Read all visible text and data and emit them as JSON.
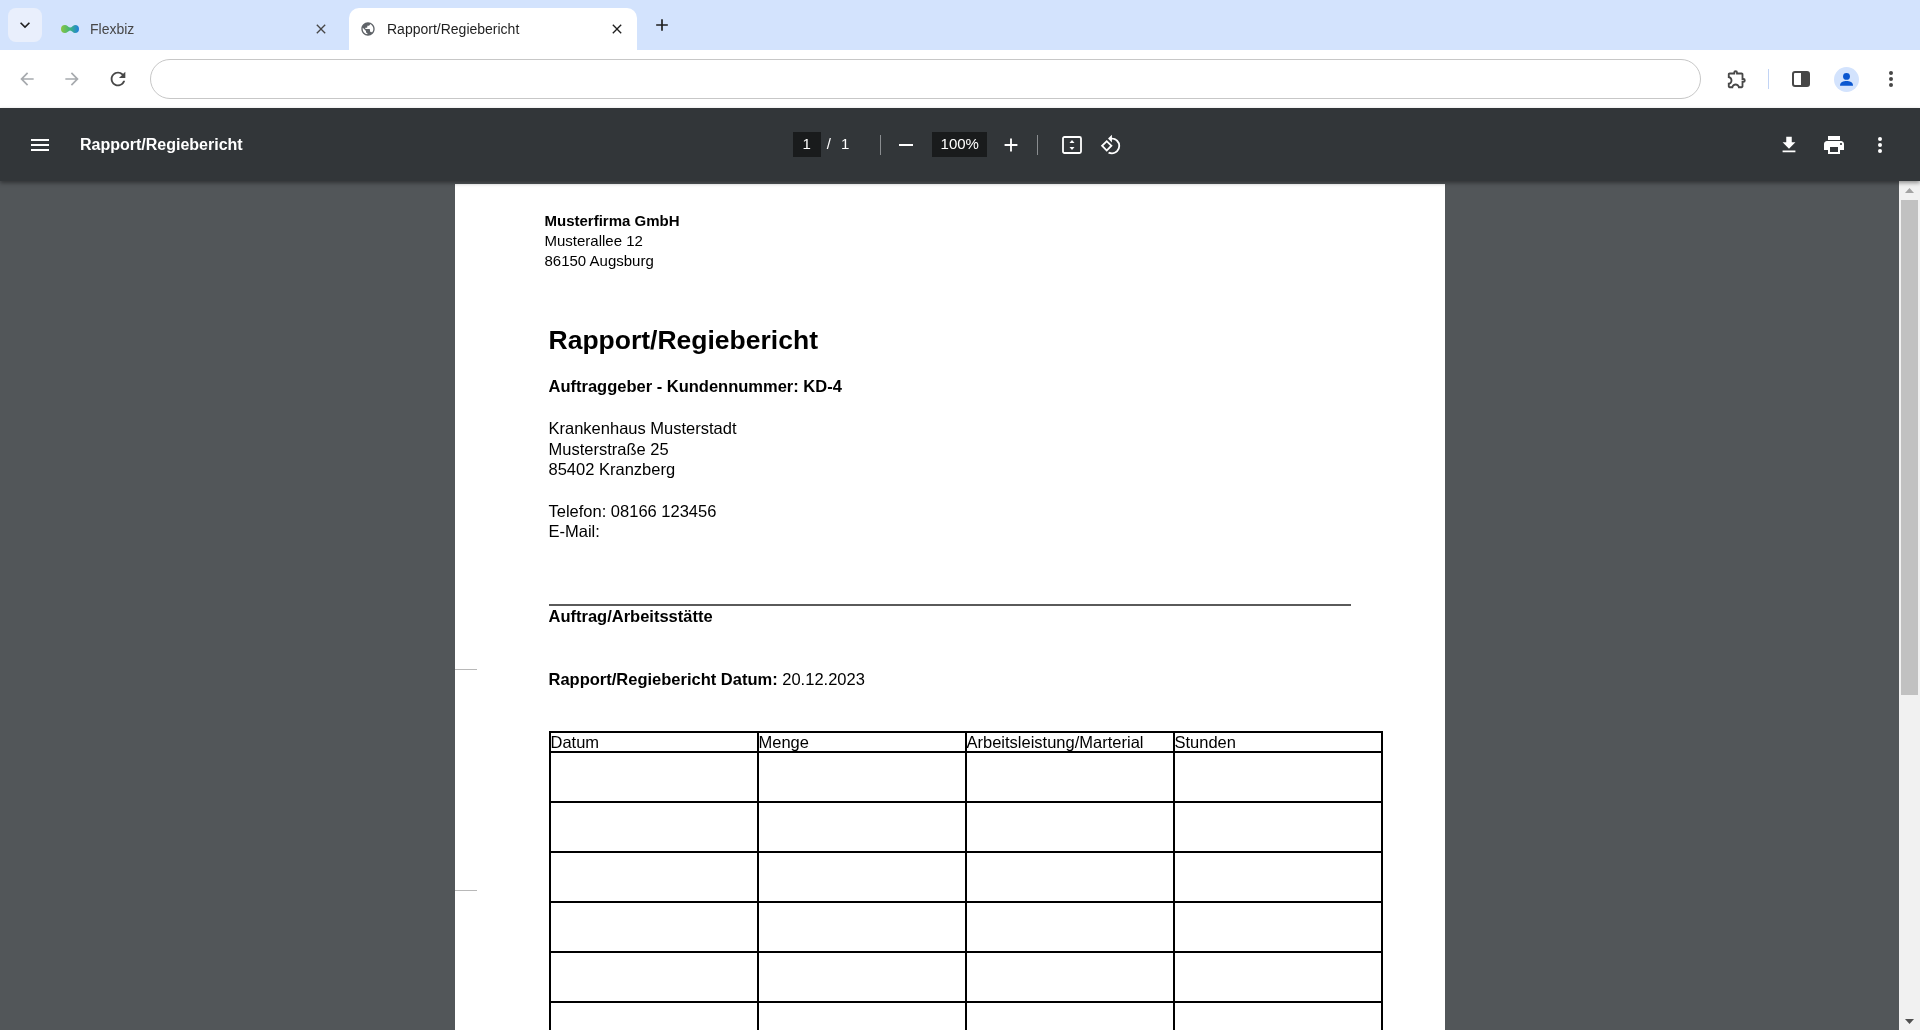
{
  "browser": {
    "tabs": [
      {
        "title": "Flexbiz",
        "selected": false
      },
      {
        "title": "Rapport/Regiebericht",
        "selected": true
      }
    ],
    "back": {
      "disabled": true
    },
    "forward": {
      "disabled": true
    }
  },
  "pdf_toolbar": {
    "title": "Rapport/Regiebericht",
    "page": "1",
    "page_separator": "/",
    "page_count": "1",
    "zoom": "100%"
  },
  "document": {
    "sender": {
      "name": "Musterfirma GmbH",
      "address": [
        "Musterallee 12",
        "86150 Augsburg"
      ]
    },
    "title": "Rapport/Regiebericht",
    "client_heading": "Auftraggeber - Kundennummer: KD-4",
    "client_address": [
      "Krankenhaus Musterstadt",
      "Musterstraße 25",
      "85402 Kranzberg"
    ],
    "contact": [
      "Telefon: 08166 123456",
      "E-Mail:"
    ],
    "section_heading": "Auftrag/Arbeitsstätte",
    "report_date": "**Rapport/Regiebericht Datum:** 20.12.2023",
    "table": {
      "columns": [
        "Datum",
        "Menge",
        "Arbeitsleistung/Marterial",
        "Stunden"
      ],
      "rows": [
        {
          "kind": "blank"
        },
        {
          "kind": "blank"
        },
        {
          "kind": "blank"
        },
        {
          "kind": "blank"
        },
        {
          "kind": "blank"
        },
        {
          "kind": "blank"
        }
      ]
    }
  }
}
